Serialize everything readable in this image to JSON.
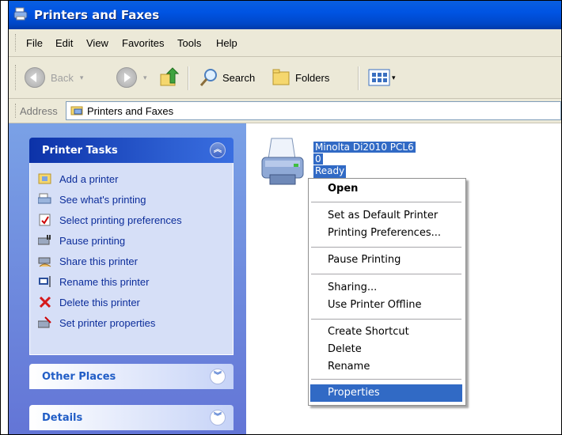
{
  "window": {
    "title": "Printers and Faxes"
  },
  "menu": [
    "File",
    "Edit",
    "View",
    "Favorites",
    "Tools",
    "Help"
  ],
  "toolbar": {
    "back": "Back",
    "search": "Search",
    "folders": "Folders"
  },
  "address": {
    "label": "Address",
    "value": "Printers and Faxes"
  },
  "panels": {
    "printer_tasks": {
      "title": "Printer Tasks",
      "items": [
        "Add a printer",
        "See what's printing",
        "Select printing preferences",
        "Pause printing",
        "Share this printer",
        "Rename this printer",
        "Delete this printer",
        "Set printer properties"
      ]
    },
    "other_places": {
      "title": "Other Places"
    },
    "details": {
      "title": "Details"
    }
  },
  "printer": {
    "name": "Minolta Di2010 PCL6",
    "documents": "0",
    "status": "Ready"
  },
  "context_menu": {
    "items": [
      "Open",
      "Set as Default Printer",
      "Printing Preferences...",
      "Pause Printing",
      "Sharing...",
      "Use Printer Offline",
      "Create Shortcut",
      "Delete",
      "Rename",
      "Properties"
    ]
  }
}
